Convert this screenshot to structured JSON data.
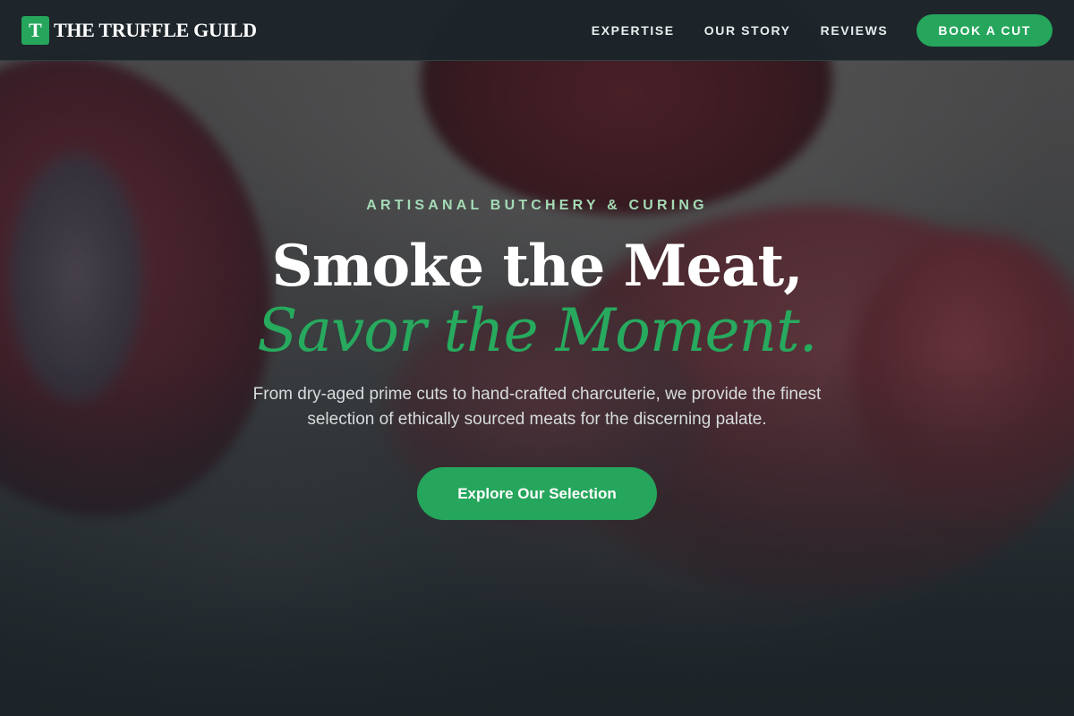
{
  "brand": {
    "mark": "T",
    "name": "THE TRUFFLE GUILD"
  },
  "nav": {
    "links": [
      {
        "label": "EXPERTISE"
      },
      {
        "label": "OUR STORY"
      },
      {
        "label": "REVIEWS"
      }
    ],
    "cta_label": "BOOK A CUT"
  },
  "hero": {
    "eyebrow": "ARTISANAL BUTCHERY & CURING",
    "headline_line1": "Smoke the Meat,",
    "headline_line2": "Savor the Moment.",
    "lead": "From dry-aged prime cuts to hand-crafted charcuterie, we provide the finest selection of ethically sourced meats for the discerning palate.",
    "cta_label": "Explore Our Selection",
    "background_image": "raw-meat-cuts-photo"
  },
  "colors": {
    "accent": "#25a65c",
    "eyebrow": "#a4dbb6",
    "nav_background": "#1c242a"
  }
}
